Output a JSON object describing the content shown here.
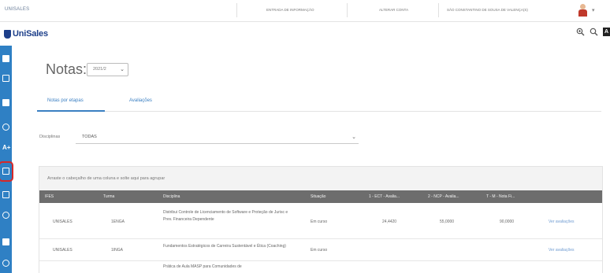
{
  "topbar": {
    "institution": "UNISALES",
    "link_1": "ENTRADA DE INFORMAÇÃO",
    "link_2": "ALTERAR CONTA",
    "user_label": "SÃO CONSTANTINO DE SOUSA DE VALENÇA(S)",
    "caret": "▾"
  },
  "brand": {
    "name": "UniSales"
  },
  "header_icons": {
    "black_badge": "A"
  },
  "sidebar": {
    "items": [
      {
        "icon": "grid-icon"
      },
      {
        "icon": "monitor-icon"
      },
      {
        "icon": "calendar-icon"
      },
      {
        "icon": "clock-icon"
      },
      {
        "icon": "grades-icon",
        "glyph": "A+"
      },
      {
        "icon": "folder-icon",
        "active": true
      },
      {
        "icon": "document-icon"
      },
      {
        "icon": "location-icon"
      },
      {
        "icon": "book-icon"
      },
      {
        "icon": "settings-icon"
      }
    ]
  },
  "page": {
    "title": "Notas:",
    "period_value": "2021/2",
    "tabs": [
      {
        "label": "Notas por etapas",
        "active": true
      },
      {
        "label": "Avaliações",
        "active": false
      }
    ],
    "discipline_label": "Disciplinas",
    "discipline_value": "TODAS"
  },
  "grid": {
    "group_hint": "Arraste o cabeçalho de uma coluna e solte aqui para agrupar",
    "columns": [
      "IFES",
      "Turma",
      "Disciplina",
      "Situação",
      "1 - ECT - Avalia...",
      "2 - NCP - Avalia...",
      "T - M - Nota Fi..."
    ],
    "rows": [
      {
        "ifes": "UNISALES",
        "turma": "1ENGA",
        "disciplina": "Distribui Controle de Licenciamento de Software e Proteção de Jurisc e Prev. Financeira Dependente",
        "situacao": "Em curso",
        "n1": "24,4420",
        "n2": "55,0000",
        "nf": "90,0000",
        "action": "Ver avaliações"
      },
      {
        "ifes": "UNISALES",
        "turma": "1INGA",
        "disciplina": "Fundamentos Estratégicos de Carreira Sustentável e Ética (Coaching)",
        "situacao": "Em curso",
        "n1": "",
        "n2": "",
        "nf": "",
        "action": "Ver avaliações"
      },
      {
        "ifes": "",
        "turma": "",
        "disciplina": "Prática de Aula MASP para Comunidades de",
        "situacao": "",
        "n1": "",
        "n2": "",
        "nf": "",
        "action": ""
      }
    ]
  }
}
